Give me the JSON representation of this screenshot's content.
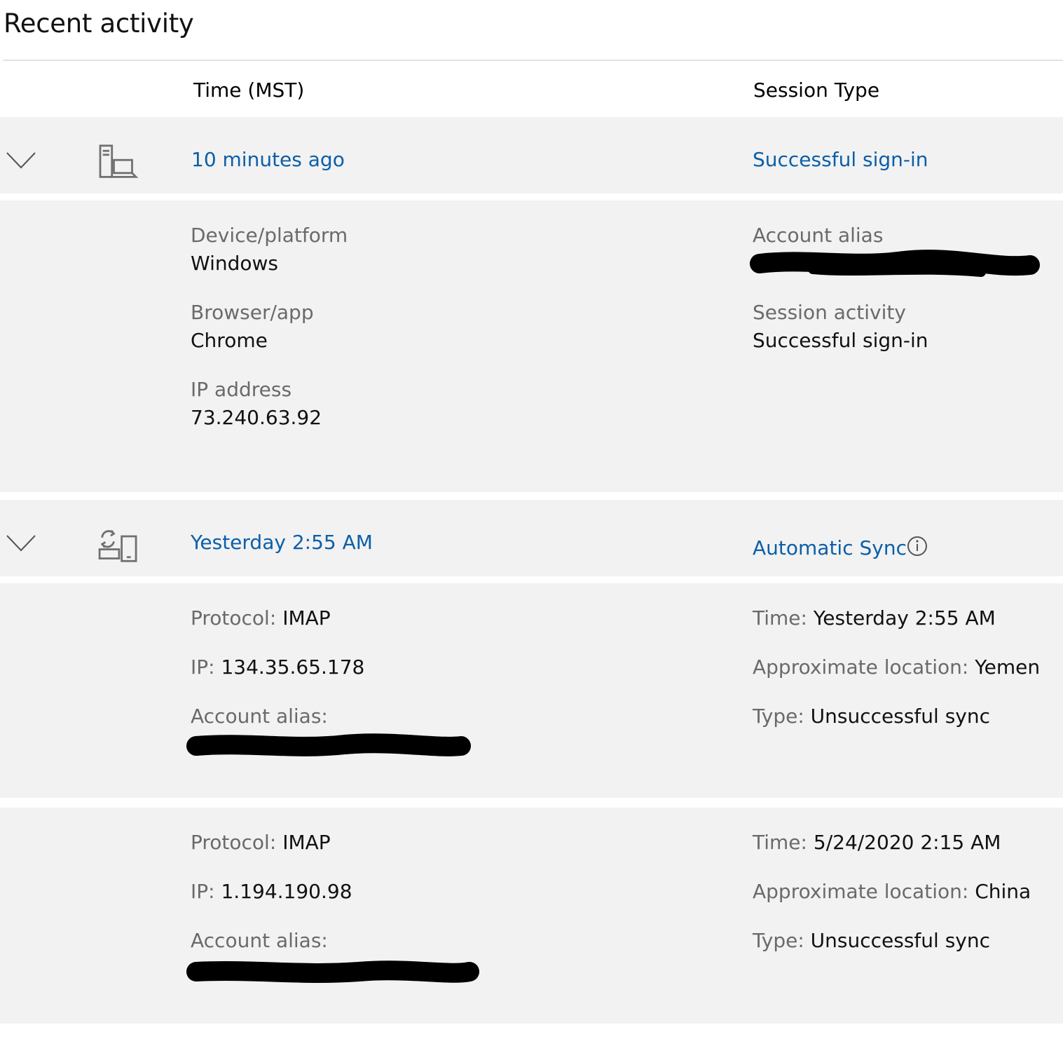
{
  "page": {
    "title": "Recent activity"
  },
  "table": {
    "col_time": "Time (MST)",
    "col_session": "Session Type"
  },
  "entry1": {
    "time": "10 minutes ago",
    "session_type": "Successful sign-in",
    "device_icon": "laptop-desktop-icon",
    "details": {
      "device_label": "Device/platform",
      "device_value": "Windows",
      "browser_label": "Browser/app",
      "browser_value": "Chrome",
      "ip_label": "IP address",
      "ip_value": "73.240.63.92",
      "alias_label": "Account alias",
      "session_activity_label": "Session activity",
      "session_activity_value": "Successful sign-in"
    }
  },
  "entry2": {
    "time": "Yesterday 2:55 AM",
    "session_type": "Automatic Sync",
    "device_icon": "sync-devices-icon",
    "info_icon": "info-icon",
    "syncs": [
      {
        "protocol_label": "Protocol:",
        "protocol_value": "IMAP",
        "ip_label": "IP:",
        "ip_value": "134.35.65.178",
        "alias_label": "Account alias:",
        "time_label": "Time:",
        "time_value": "Yesterday 2:55 AM",
        "location_label": "Approximate location:",
        "location_value": "Yemen",
        "type_label": "Type:",
        "type_value": "Unsuccessful sync"
      },
      {
        "protocol_label": "Protocol:",
        "protocol_value": "IMAP",
        "ip_label": "IP:",
        "ip_value": "1.194.190.98",
        "alias_label": "Account alias:",
        "time_label": "Time:",
        "time_value": "5/24/2020 2:15 AM",
        "location_label": "Approximate location:",
        "location_value": "China",
        "type_label": "Type:",
        "type_value": "Unsuccessful sync"
      }
    ]
  },
  "colors": {
    "link": "#0b5fa8",
    "band": "#f2f2f2",
    "label": "#6a6a6a"
  }
}
